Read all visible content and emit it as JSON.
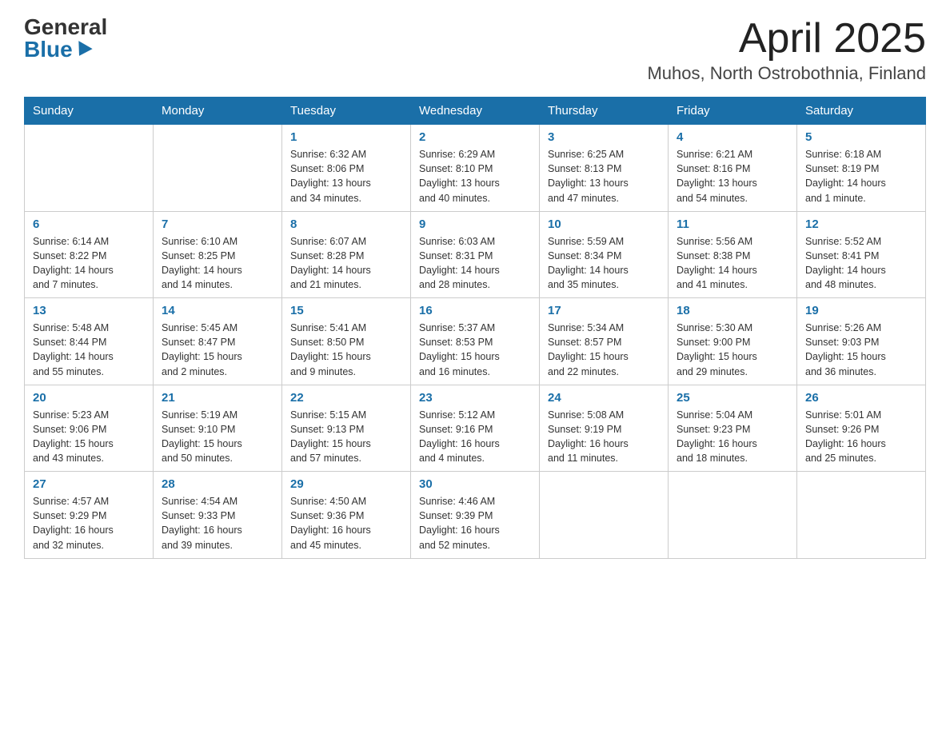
{
  "header": {
    "logo_general": "General",
    "logo_blue": "Blue",
    "month_title": "April 2025",
    "location": "Muhos, North Ostrobothnia, Finland"
  },
  "weekdays": [
    "Sunday",
    "Monday",
    "Tuesday",
    "Wednesday",
    "Thursday",
    "Friday",
    "Saturday"
  ],
  "weeks": [
    [
      {
        "day": "",
        "info": ""
      },
      {
        "day": "",
        "info": ""
      },
      {
        "day": "1",
        "info": "Sunrise: 6:32 AM\nSunset: 8:06 PM\nDaylight: 13 hours\nand 34 minutes."
      },
      {
        "day": "2",
        "info": "Sunrise: 6:29 AM\nSunset: 8:10 PM\nDaylight: 13 hours\nand 40 minutes."
      },
      {
        "day": "3",
        "info": "Sunrise: 6:25 AM\nSunset: 8:13 PM\nDaylight: 13 hours\nand 47 minutes."
      },
      {
        "day": "4",
        "info": "Sunrise: 6:21 AM\nSunset: 8:16 PM\nDaylight: 13 hours\nand 54 minutes."
      },
      {
        "day": "5",
        "info": "Sunrise: 6:18 AM\nSunset: 8:19 PM\nDaylight: 14 hours\nand 1 minute."
      }
    ],
    [
      {
        "day": "6",
        "info": "Sunrise: 6:14 AM\nSunset: 8:22 PM\nDaylight: 14 hours\nand 7 minutes."
      },
      {
        "day": "7",
        "info": "Sunrise: 6:10 AM\nSunset: 8:25 PM\nDaylight: 14 hours\nand 14 minutes."
      },
      {
        "day": "8",
        "info": "Sunrise: 6:07 AM\nSunset: 8:28 PM\nDaylight: 14 hours\nand 21 minutes."
      },
      {
        "day": "9",
        "info": "Sunrise: 6:03 AM\nSunset: 8:31 PM\nDaylight: 14 hours\nand 28 minutes."
      },
      {
        "day": "10",
        "info": "Sunrise: 5:59 AM\nSunset: 8:34 PM\nDaylight: 14 hours\nand 35 minutes."
      },
      {
        "day": "11",
        "info": "Sunrise: 5:56 AM\nSunset: 8:38 PM\nDaylight: 14 hours\nand 41 minutes."
      },
      {
        "day": "12",
        "info": "Sunrise: 5:52 AM\nSunset: 8:41 PM\nDaylight: 14 hours\nand 48 minutes."
      }
    ],
    [
      {
        "day": "13",
        "info": "Sunrise: 5:48 AM\nSunset: 8:44 PM\nDaylight: 14 hours\nand 55 minutes."
      },
      {
        "day": "14",
        "info": "Sunrise: 5:45 AM\nSunset: 8:47 PM\nDaylight: 15 hours\nand 2 minutes."
      },
      {
        "day": "15",
        "info": "Sunrise: 5:41 AM\nSunset: 8:50 PM\nDaylight: 15 hours\nand 9 minutes."
      },
      {
        "day": "16",
        "info": "Sunrise: 5:37 AM\nSunset: 8:53 PM\nDaylight: 15 hours\nand 16 minutes."
      },
      {
        "day": "17",
        "info": "Sunrise: 5:34 AM\nSunset: 8:57 PM\nDaylight: 15 hours\nand 22 minutes."
      },
      {
        "day": "18",
        "info": "Sunrise: 5:30 AM\nSunset: 9:00 PM\nDaylight: 15 hours\nand 29 minutes."
      },
      {
        "day": "19",
        "info": "Sunrise: 5:26 AM\nSunset: 9:03 PM\nDaylight: 15 hours\nand 36 minutes."
      }
    ],
    [
      {
        "day": "20",
        "info": "Sunrise: 5:23 AM\nSunset: 9:06 PM\nDaylight: 15 hours\nand 43 minutes."
      },
      {
        "day": "21",
        "info": "Sunrise: 5:19 AM\nSunset: 9:10 PM\nDaylight: 15 hours\nand 50 minutes."
      },
      {
        "day": "22",
        "info": "Sunrise: 5:15 AM\nSunset: 9:13 PM\nDaylight: 15 hours\nand 57 minutes."
      },
      {
        "day": "23",
        "info": "Sunrise: 5:12 AM\nSunset: 9:16 PM\nDaylight: 16 hours\nand 4 minutes."
      },
      {
        "day": "24",
        "info": "Sunrise: 5:08 AM\nSunset: 9:19 PM\nDaylight: 16 hours\nand 11 minutes."
      },
      {
        "day": "25",
        "info": "Sunrise: 5:04 AM\nSunset: 9:23 PM\nDaylight: 16 hours\nand 18 minutes."
      },
      {
        "day": "26",
        "info": "Sunrise: 5:01 AM\nSunset: 9:26 PM\nDaylight: 16 hours\nand 25 minutes."
      }
    ],
    [
      {
        "day": "27",
        "info": "Sunrise: 4:57 AM\nSunset: 9:29 PM\nDaylight: 16 hours\nand 32 minutes."
      },
      {
        "day": "28",
        "info": "Sunrise: 4:54 AM\nSunset: 9:33 PM\nDaylight: 16 hours\nand 39 minutes."
      },
      {
        "day": "29",
        "info": "Sunrise: 4:50 AM\nSunset: 9:36 PM\nDaylight: 16 hours\nand 45 minutes."
      },
      {
        "day": "30",
        "info": "Sunrise: 4:46 AM\nSunset: 9:39 PM\nDaylight: 16 hours\nand 52 minutes."
      },
      {
        "day": "",
        "info": ""
      },
      {
        "day": "",
        "info": ""
      },
      {
        "day": "",
        "info": ""
      }
    ]
  ]
}
